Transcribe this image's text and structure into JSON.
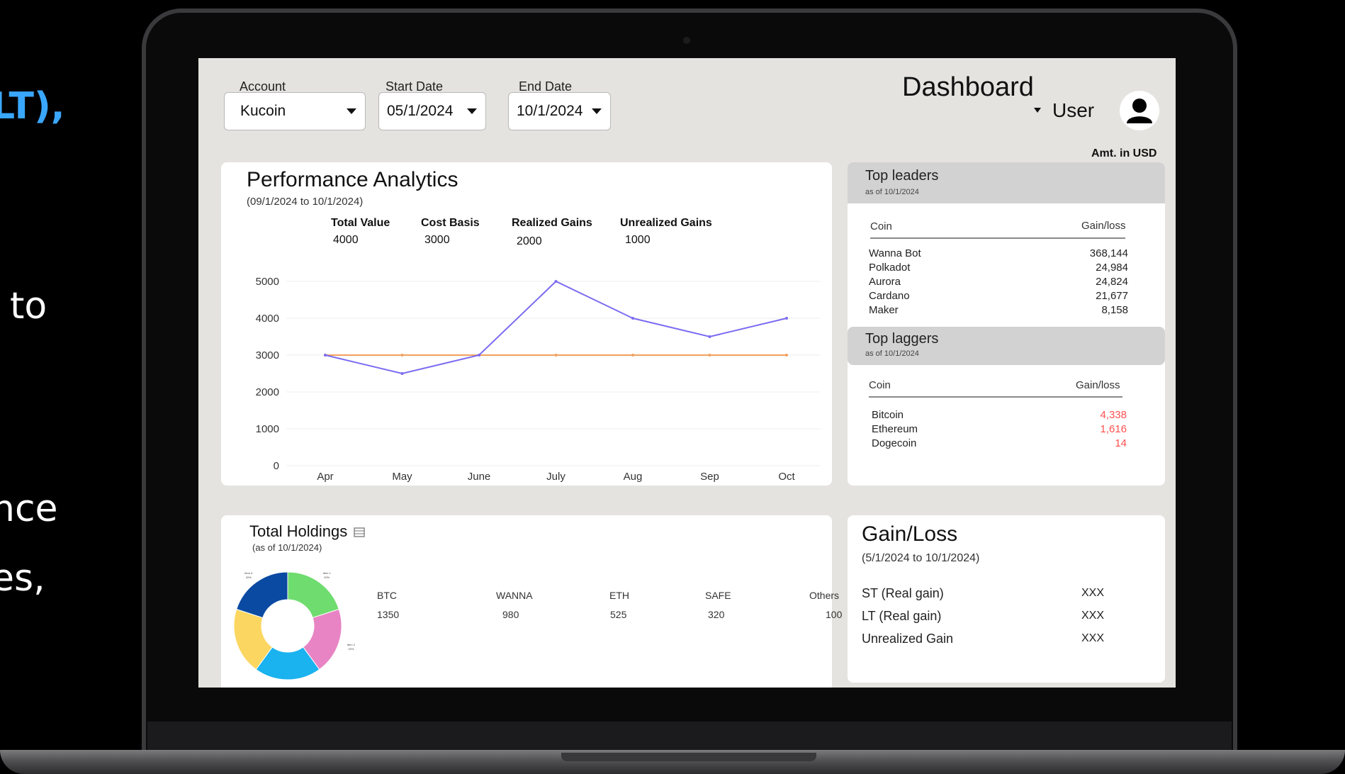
{
  "side_text": [
    "LT),",
    "to",
    "nce",
    "es,"
  ],
  "header": {
    "account_label": "Account",
    "account_value": "Kucoin",
    "start_label": "Start Date",
    "start_value": "05/1/2024",
    "end_label": "End Date",
    "end_value": "10/1/2024",
    "title": "Dashboard",
    "user_label": "User",
    "currency_note": "Amt. in USD"
  },
  "performance": {
    "title": "Performance Analytics",
    "range": "(09/1/2024 to 10/1/2024)",
    "metrics": [
      {
        "label": "Total Value",
        "value": "4000"
      },
      {
        "label": "Cost Basis",
        "value": "3000"
      },
      {
        "label": "Realized Gains",
        "value": "2000"
      },
      {
        "label": "Unrealized Gains",
        "value": "1000"
      }
    ]
  },
  "chart_data": {
    "type": "line",
    "categories": [
      "Apr",
      "May",
      "June",
      "July",
      "Aug",
      "Sep",
      "Oct"
    ],
    "series": [
      {
        "values": [
          3000,
          2500,
          3000,
          5000,
          4000,
          3500,
          4000
        ],
        "color": "#7b6cf0"
      },
      {
        "values": [
          3000,
          3000,
          3000,
          3000,
          3000,
          3000,
          3000
        ],
        "color": "#f0a060"
      }
    ],
    "yticks": [
      "0",
      "1000",
      "2000",
      "3000",
      "4000",
      "5000"
    ],
    "ylim": [
      0,
      5000
    ],
    "grid": true
  },
  "leaders": {
    "title": "Top leaders",
    "as_of": "as of 10/1/2024",
    "col_coin": "Coin",
    "col_gain": "Gain/loss",
    "rows": [
      {
        "coin": "Wanna Bot",
        "value": "368,144"
      },
      {
        "coin": "Polkadot",
        "value": "24,984"
      },
      {
        "coin": "Aurora",
        "value": "24,824"
      },
      {
        "coin": "Cardano",
        "value": "21,677"
      },
      {
        "coin": "Maker",
        "value": "8,158"
      }
    ]
  },
  "laggers": {
    "title": "Top laggers",
    "as_of": "as of 10/1/2024",
    "col_coin": "Coin",
    "col_gain": "Gain/loss",
    "rows": [
      {
        "coin": "Bitcoin",
        "value": "4,338"
      },
      {
        "coin": "Ethereum",
        "value": "1,616"
      },
      {
        "coin": "Dogecoin",
        "value": "14"
      }
    ]
  },
  "holdings": {
    "title": "Total Holdings",
    "as_of": "(as of 10/1/2024)",
    "columns": [
      {
        "coin": "BTC",
        "value": "1350"
      },
      {
        "coin": "WANNA",
        "value": "980"
      },
      {
        "coin": "ETH",
        "value": "525"
      },
      {
        "coin": "SAFE",
        "value": "320"
      },
      {
        "coin": "Others",
        "value": "100"
      }
    ],
    "donut": [
      {
        "label": "Item 1",
        "pct": "20%",
        "share": 0.2,
        "color": "#6fdc6f"
      },
      {
        "label": "Item 2",
        "pct": "20%",
        "share": 0.2,
        "color": "#e884c4"
      },
      {
        "label": "Item 3",
        "pct": "20%",
        "share": 0.2,
        "color": "#1ab2ef"
      },
      {
        "label": "Item 4",
        "pct": "20%",
        "share": 0.2,
        "color": "#fbd660"
      },
      {
        "label": "Item 5",
        "pct": "20%",
        "share": 0.2,
        "color": "#0b4aa2"
      }
    ]
  },
  "gainloss": {
    "title": "Gain/Loss",
    "range": "(5/1/2024 to 10/1/2024)",
    "rows": [
      {
        "label": "ST (Real gain)",
        "value": "XXX"
      },
      {
        "label": "LT (Real gain)",
        "value": "XXX"
      },
      {
        "label": "Unrealized Gain",
        "value": "XXX"
      }
    ]
  }
}
